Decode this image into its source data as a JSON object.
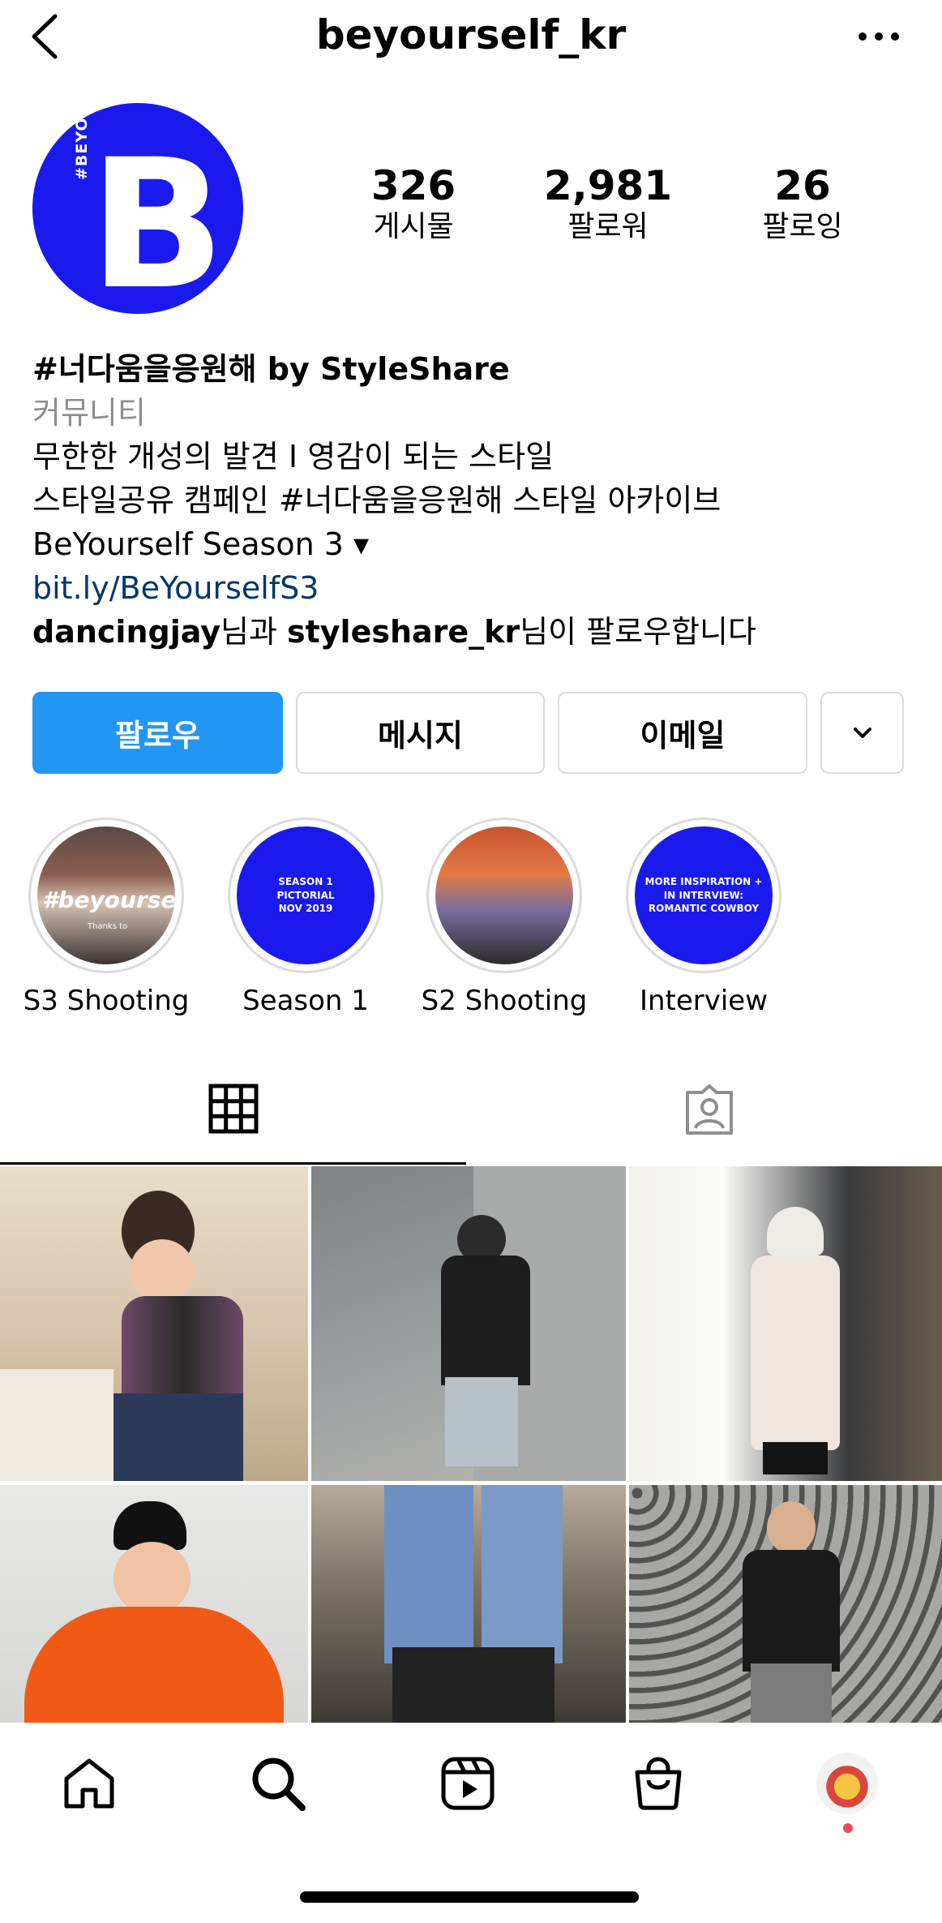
{
  "header": {
    "username": "beyourself_kr"
  },
  "profile": {
    "avatar_text": "#BEYOURSELF",
    "avatar_letter": "B",
    "stats": [
      {
        "value": "326",
        "label": "게시물"
      },
      {
        "value": "2,981",
        "label": "팔로워"
      },
      {
        "value": "26",
        "label": "팔로잉"
      }
    ],
    "name": "#너다움을응원해 by StyleShare",
    "category": "커뮤니티",
    "bio_line1": "무한한 개성의 발견 I 영감이 되는 스타일",
    "bio_line2": "스타일공유 캠페인 #너다움을응원해 스타일 아카이브",
    "bio_line3": "BeYourself Season 3 ▾",
    "link": "bit.ly/BeYourselfS3",
    "followed_by": {
      "user1": "dancingjay",
      "connector": "님과 ",
      "user2": "styleshare_kr",
      "suffix": "님이 팔로우합니다"
    }
  },
  "buttons": {
    "follow": "팔로우",
    "message": "메시지",
    "email": "이메일"
  },
  "highlights": [
    {
      "label": "S3 Shooting",
      "overlay": "#beyourself",
      "caption": "Thanks to"
    },
    {
      "label": "Season 1",
      "text": "SEASON 1\nPICTORIAL\nNOV 2019"
    },
    {
      "label": "S2 Shooting"
    },
    {
      "label": "Interview",
      "text": "MORE INSPIRATION +\nIN INTERVIEW:\nROMANTIC COWBOY"
    }
  ],
  "colors": {
    "brand_blue": "#1a1aef",
    "follow_button": "#2196f3",
    "link": "#00376b",
    "notification_dot": "#ed4956"
  }
}
